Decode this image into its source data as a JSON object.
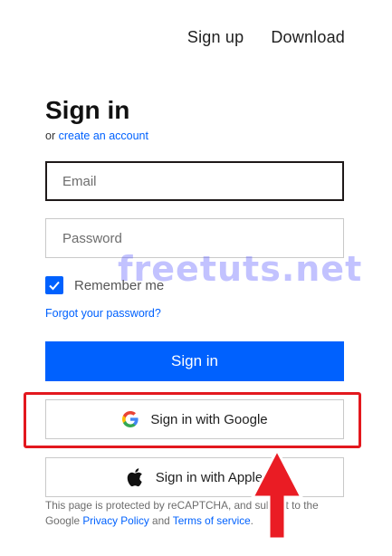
{
  "nav": {
    "signup": "Sign up",
    "download": "Download"
  },
  "form": {
    "title": "Sign in",
    "subtitle_prefix": "or",
    "create_account": "create an account",
    "email_placeholder": "Email",
    "password_placeholder": "Password",
    "remember_label": "Remember me",
    "remember_checked": true,
    "forgot": "Forgot your password?",
    "signin_button": "Sign in",
    "google_button": "Sign in with Google",
    "apple_button": "Sign in with Apple"
  },
  "legal": {
    "text1": "This page is protected by reCAPTCHA, and subject to the Google",
    "privacy": "Privacy Policy",
    "and": "and",
    "terms": "Terms of service",
    "period": "."
  },
  "watermark": "freetuts.net",
  "colors": {
    "accent": "#0061fe",
    "highlight": "#e3181e",
    "google_blue": "#4285f4",
    "google_red": "#ea4335",
    "google_yellow": "#fbbc05",
    "google_green": "#34a853"
  },
  "icons": {
    "google": "google-g-icon",
    "apple": "apple-logo-icon",
    "check": "checkmark-icon"
  }
}
